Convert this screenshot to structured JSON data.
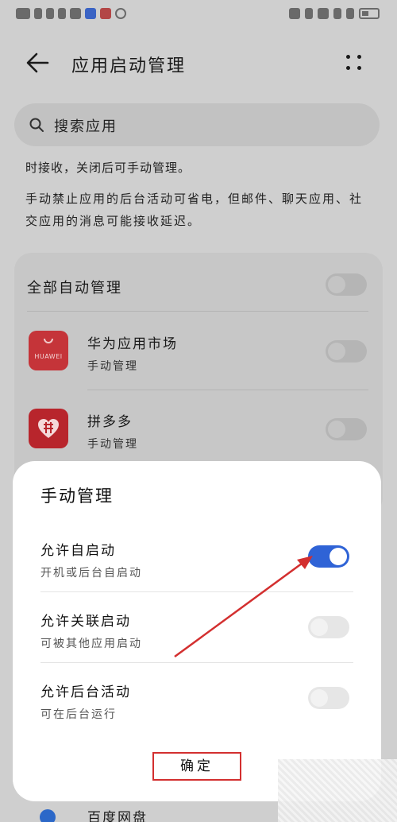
{
  "header": {
    "title": "应用启动管理"
  },
  "search": {
    "placeholder": "搜索应用"
  },
  "info": {
    "line1": "时接收，关闭后可手动管理。",
    "line2": "手动禁止应用的后台活动可省电，但邮件、聊天应用、社交应用的消息可能接收延迟。"
  },
  "list": {
    "all_auto_label": "全部自动管理",
    "apps": [
      {
        "name": "华为应用市场",
        "status": "手动管理",
        "icon_text": "HUAWEI"
      },
      {
        "name": "拼多多",
        "status": "手动管理"
      }
    ],
    "bottom_peek_label": "百度网盘"
  },
  "dialog": {
    "title": "手动管理",
    "options": [
      {
        "label": "允许自启动",
        "sub": "开机或后台自启动",
        "enabled": true
      },
      {
        "label": "允许关联启动",
        "sub": "可被其他应用启动",
        "enabled": false
      },
      {
        "label": "允许后台活动",
        "sub": "可在后台运行",
        "enabled": false
      }
    ],
    "confirm_label": "确定"
  },
  "colors": {
    "toggle_on": "#2f63d6",
    "annotation": "#d32f2f",
    "dim_background": "#cfcfcf"
  }
}
